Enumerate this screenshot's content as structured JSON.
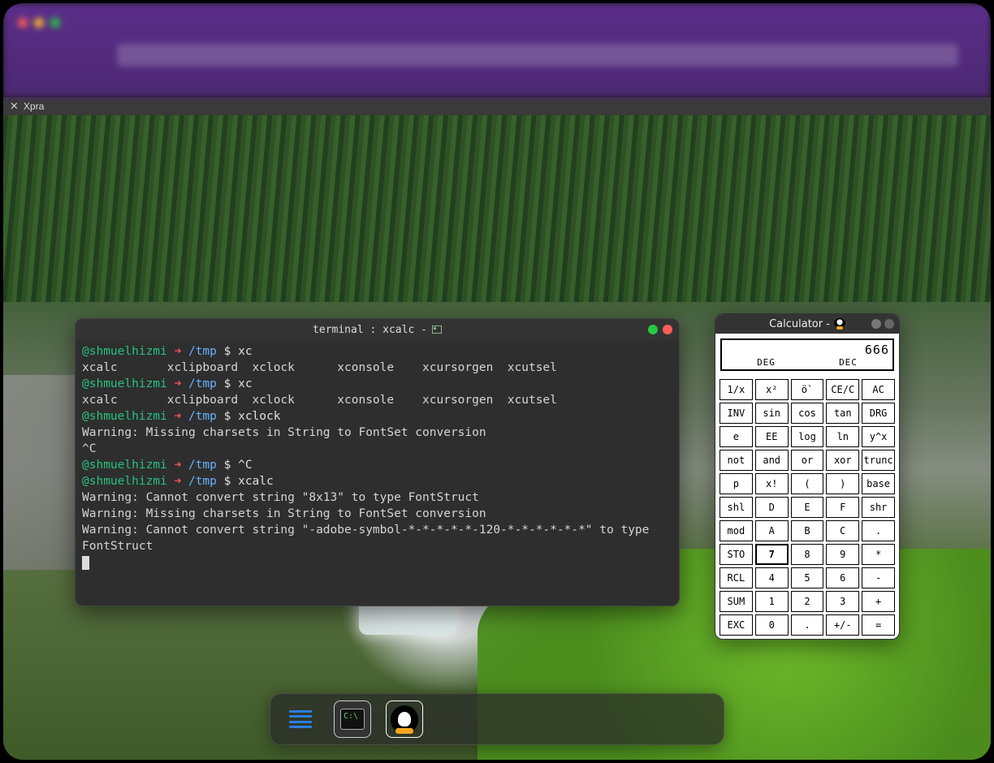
{
  "xpra": {
    "label": "Xpra"
  },
  "terminal": {
    "title": "terminal : xcalc -",
    "prompt": {
      "user": "@shmuelhizmi",
      "path": "/tmp",
      "sigil": "$",
      "arrow": "➜"
    },
    "lines": [
      {
        "kind": "prompt",
        "cmd": "xc"
      },
      {
        "kind": "out",
        "text": "xcalc       xclipboard  xclock      xconsole    xcursorgen  xcutsel"
      },
      {
        "kind": "prompt",
        "cmd": "xc"
      },
      {
        "kind": "out",
        "text": "xcalc       xclipboard  xclock      xconsole    xcursorgen  xcutsel"
      },
      {
        "kind": "prompt",
        "cmd": "xclock"
      },
      {
        "kind": "out",
        "text": "Warning: Missing charsets in String to FontSet conversion"
      },
      {
        "kind": "out",
        "text": "^C"
      },
      {
        "kind": "prompt",
        "cmd": "^C"
      },
      {
        "kind": "prompt",
        "cmd": "xcalc"
      },
      {
        "kind": "out",
        "text": "Warning: Cannot convert string \"8x13\" to type FontStruct"
      },
      {
        "kind": "out",
        "text": "Warning: Missing charsets in String to FontSet conversion"
      },
      {
        "kind": "out",
        "text": "Warning: Cannot convert string \"-adobe-symbol-*-*-*-*-*-120-*-*-*-*-*-*\" to type"
      },
      {
        "kind": "out",
        "text": "FontStruct"
      }
    ]
  },
  "calculator": {
    "title": "Calculator -",
    "display": {
      "value": "666",
      "mode_left": "DEG",
      "mode_right": "DEC"
    },
    "rows": [
      [
        "1/x",
        "x²",
        "ö`",
        "CE/C",
        "AC"
      ],
      [
        "INV",
        "sin",
        "cos",
        "tan",
        "DRG"
      ],
      [
        "e",
        "EE",
        "log",
        "ln",
        "y^x"
      ],
      [
        "not",
        "and",
        "or",
        "xor",
        "trunc"
      ],
      [
        "p",
        "x!",
        "(",
        ")",
        "base"
      ],
      [
        "shl",
        "D",
        "E",
        "F",
        "shr"
      ],
      [
        "mod",
        "A",
        "B",
        "C",
        "."
      ],
      [
        "STO",
        "7",
        "8",
        "9",
        "*"
      ],
      [
        "RCL",
        "4",
        "5",
        "6",
        "-"
      ],
      [
        "SUM",
        "1",
        "2",
        "3",
        "+"
      ],
      [
        "EXC",
        "0",
        ".",
        "+/-",
        "="
      ]
    ],
    "pressed": "7"
  },
  "dock": {
    "items": [
      {
        "id": "menu",
        "active": false
      },
      {
        "id": "terminal",
        "active": true
      },
      {
        "id": "penguin",
        "active": false
      }
    ]
  }
}
